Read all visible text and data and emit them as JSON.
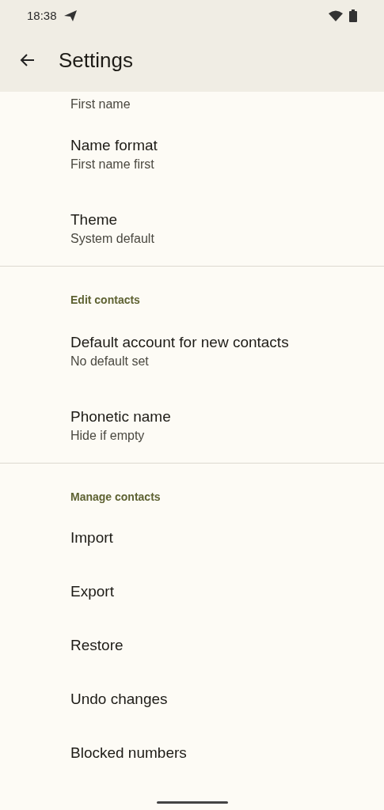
{
  "status_bar": {
    "time": "18:38"
  },
  "app_bar": {
    "title": "Settings"
  },
  "sections": [
    {
      "items": [
        {
          "subtitle": "First name"
        },
        {
          "title": "Name format",
          "subtitle": "First name first"
        },
        {
          "title": "Theme",
          "subtitle": "System default"
        }
      ]
    },
    {
      "header": "Edit contacts",
      "items": [
        {
          "title": "Default account for new contacts",
          "subtitle": "No default set"
        },
        {
          "title": "Phonetic name",
          "subtitle": "Hide if empty"
        }
      ]
    },
    {
      "header": "Manage contacts",
      "items": [
        {
          "title": "Import"
        },
        {
          "title": "Export"
        },
        {
          "title": "Restore"
        },
        {
          "title": "Undo changes"
        },
        {
          "title": "Blocked numbers"
        }
      ]
    }
  ]
}
